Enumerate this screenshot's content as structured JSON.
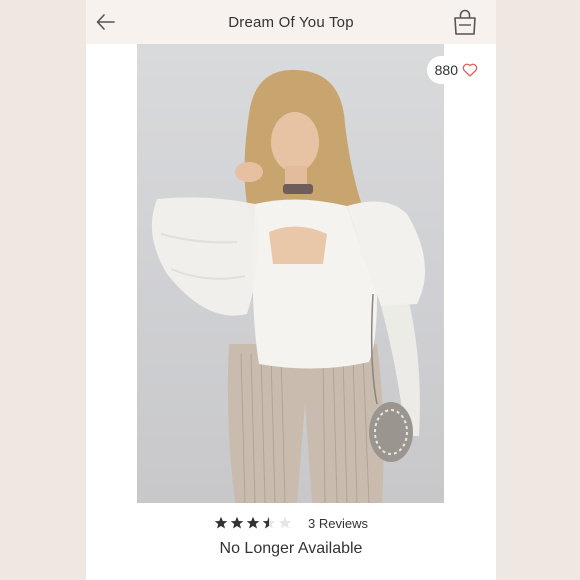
{
  "header": {
    "title": "Dream Of You Top",
    "back_icon": "arrow-left-icon",
    "bag_icon": "shopping-bag-icon"
  },
  "likes": {
    "count": "880",
    "icon": "heart-outline-icon",
    "color": "#e0605a"
  },
  "rating": {
    "value": 3.5,
    "max": 5,
    "reviews_label": "3 Reviews"
  },
  "availability": {
    "label": "No Longer Available"
  }
}
